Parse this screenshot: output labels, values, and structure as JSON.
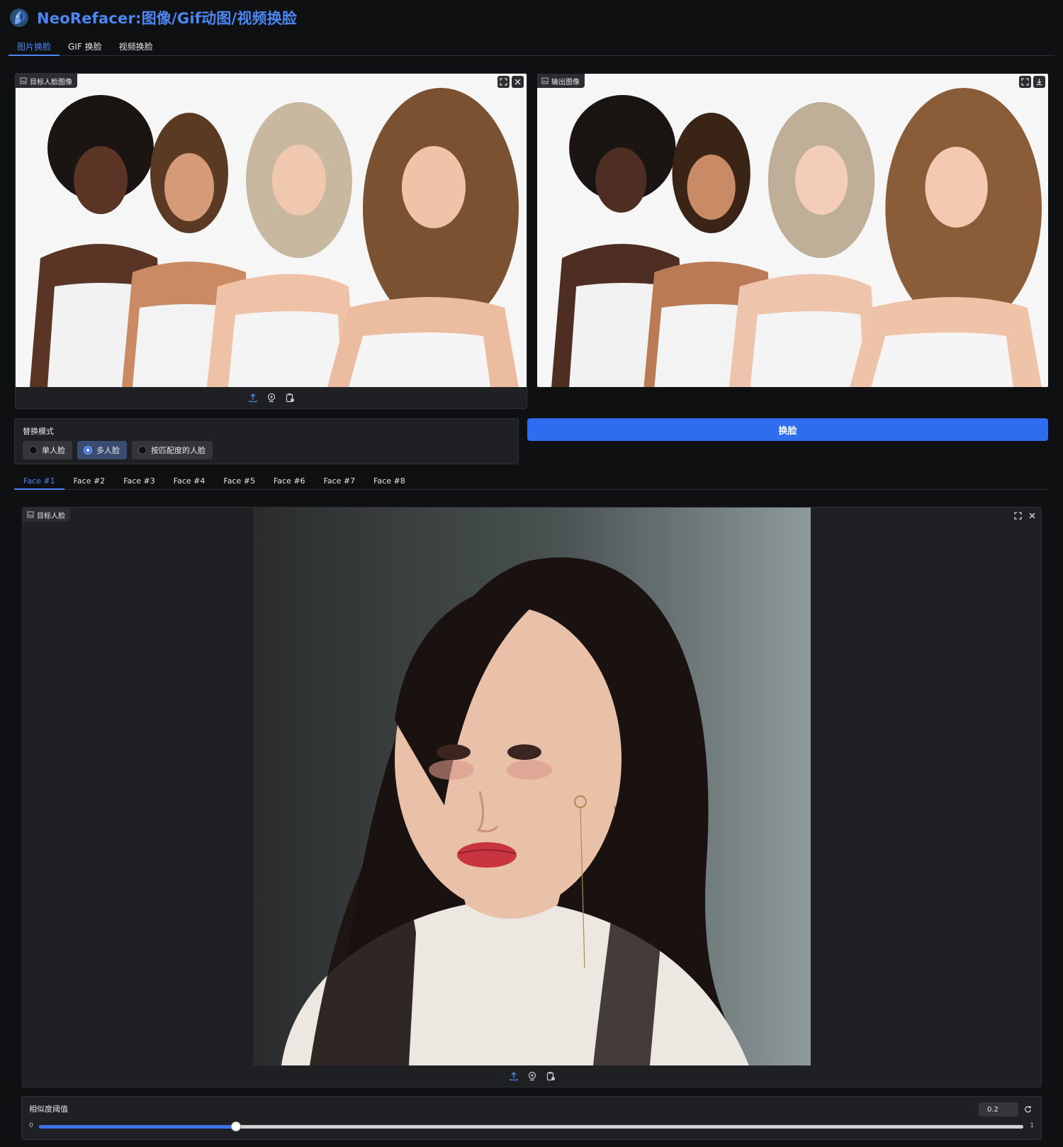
{
  "app": {
    "title": "NeoRefacer:图像/Gif动图/视频换脸",
    "tabs": [
      "图片换脸",
      "GIF 换脸",
      "视频换脸"
    ],
    "active_tab": 0
  },
  "target_image": {
    "label": "目标人脸图像",
    "icons": [
      "fullscreen-icon",
      "close-icon"
    ]
  },
  "output_image": {
    "label": "输出图像",
    "icons": [
      "fullscreen-icon",
      "download-icon"
    ]
  },
  "source_toolbar": {
    "icons": [
      "upload-icon",
      "webcam-icon",
      "clipboard-icon"
    ]
  },
  "swap_mode": {
    "title": "替换模式",
    "options": [
      "单人脸",
      "多人脸",
      "按匹配度的人脸"
    ],
    "selected": "多人脸"
  },
  "swap_button": {
    "label": "换脸"
  },
  "face_tabs": {
    "items": [
      "Face #1",
      "Face #2",
      "Face #3",
      "Face #4",
      "Face #5",
      "Face #6",
      "Face #7",
      "Face #8"
    ],
    "active": 0
  },
  "face_image": {
    "label": "目标人脸"
  },
  "threshold": {
    "label": "相似度阈值",
    "value": "0.2",
    "numeric_value": 0.2,
    "min": "0",
    "max": "1"
  },
  "colors": {
    "accent": "#2f6df0",
    "title": "#4c86f5",
    "background": "#0f1012",
    "panel": "#1f2023"
  }
}
